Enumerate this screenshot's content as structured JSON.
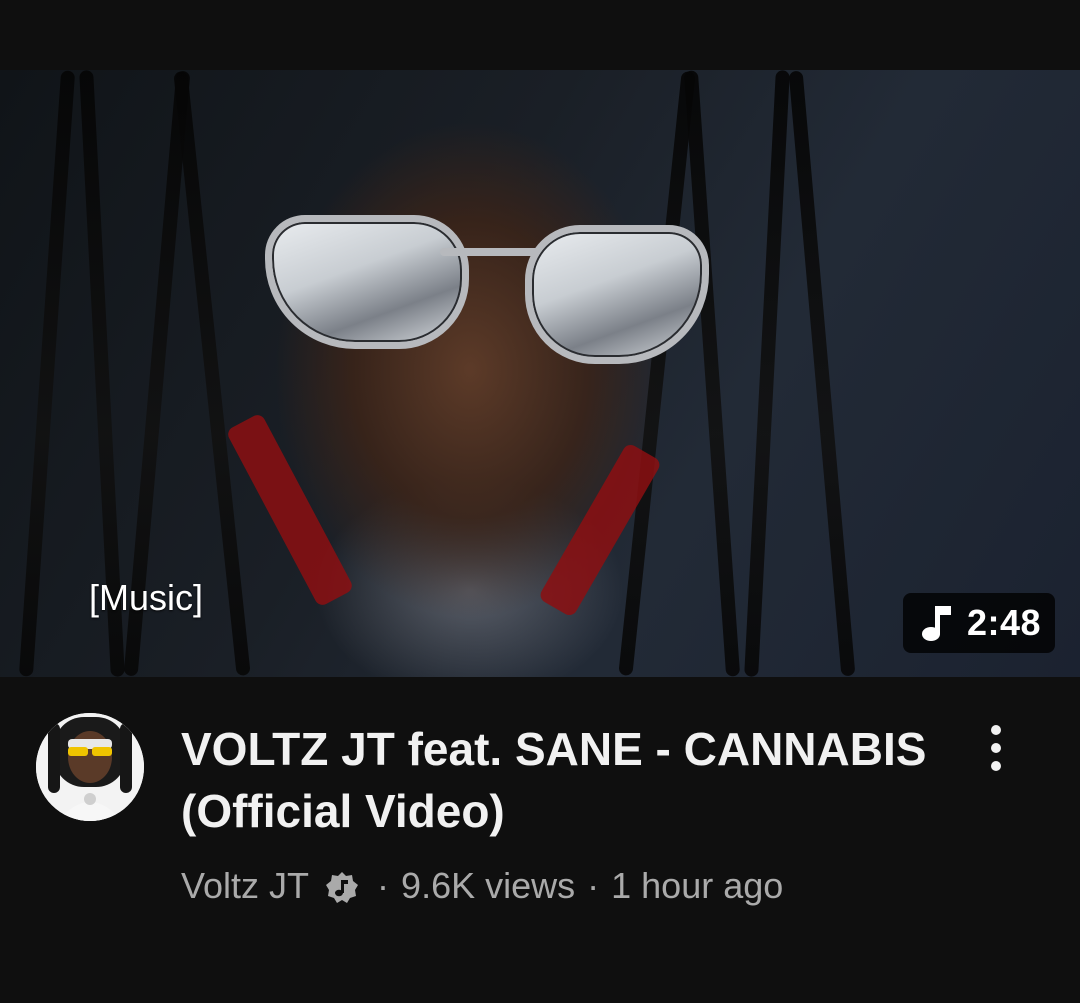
{
  "video": {
    "caption": "[Music]",
    "duration": "2:48",
    "duration_icon": "music-note-icon",
    "title": "VOLTZ JT feat. SANE - CANNABIS (Official Video)",
    "channel": "Voltz JT",
    "channel_badge_icon": "verified-music-icon",
    "views": "9.6K views",
    "age": "1 hour ago",
    "separator": "·",
    "menu_icon": "more-vertical-icon"
  },
  "colors": {
    "background": "#0f0f0f",
    "title": "#f1f1f1",
    "meta": "#aaaaaa"
  }
}
